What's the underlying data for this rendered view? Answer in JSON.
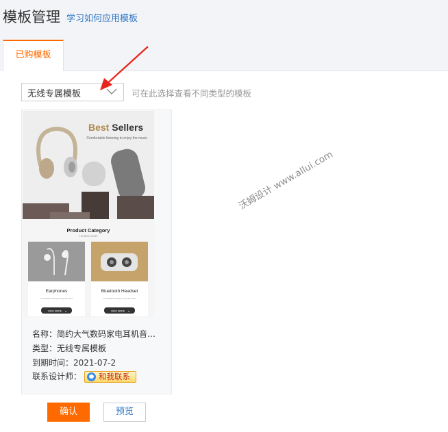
{
  "header": {
    "title": "模板管理",
    "help_link": "学习如何应用模板"
  },
  "tabs": [
    {
      "label": "已购模板",
      "active": true
    }
  ],
  "filter": {
    "selected": "无线专属模板",
    "hint": "可在此选择查看不同类型的模板"
  },
  "template_card": {
    "preview": {
      "headline_accent": "Best",
      "headline_rest": " Sellers",
      "tagline": "Comfortable listening to enjoy the music",
      "section_title": "Product Category",
      "section_sub": "The Best of 2019",
      "products": [
        {
          "name": "Earphones",
          "desc": "Comfortable listening to enjoy the music",
          "button": "VIEW MORE"
        },
        {
          "name": "Bluetooth Headset",
          "desc": "Comfortable listening to enjoy the music",
          "button": "VIEW MORE"
        }
      ]
    },
    "name_label": "名称：",
    "name_value": "简约大气数码家电耳机音…",
    "type_label": "类型：",
    "type_value": "无线专属模板",
    "expiry_label": "到期时间：",
    "expiry_value": "2021-07-2",
    "contact_label": "联系设计师：",
    "contact_button": "和我联系"
  },
  "actions": {
    "confirm": "确认",
    "preview": "预览"
  },
  "watermark": "沃姆设计 www.allui.com",
  "colors": {
    "accent": "#ff6a00",
    "link": "#3178c8",
    "annotation_arrow": "#e8231a"
  },
  "icons": [
    "chevron-down-icon",
    "qq-icon",
    "annotation-arrow-icon"
  ]
}
